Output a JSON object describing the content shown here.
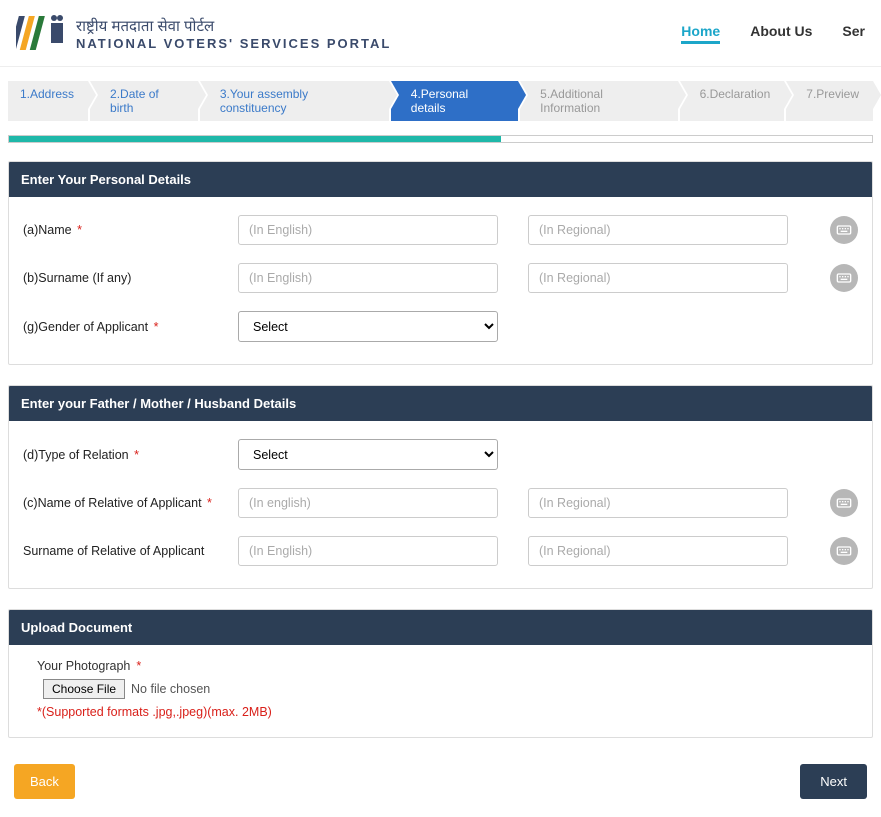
{
  "header": {
    "hindi": "राष्ट्रीय मतदाता सेवा पोर्टल",
    "english": "NATIONAL VOTERS' SERVICES PORTAL"
  },
  "nav": {
    "home": "Home",
    "about": "About Us",
    "ser": "Ser"
  },
  "steps": [
    {
      "label": "1.Address",
      "state": "done"
    },
    {
      "label": "2.Date of birth",
      "state": "done"
    },
    {
      "label": "3.Your assembly constituency",
      "state": "done"
    },
    {
      "label": "4.Personal details",
      "state": "active"
    },
    {
      "label": "5.Additional Information",
      "state": "future"
    },
    {
      "label": "6.Declaration",
      "state": "future"
    },
    {
      "label": "7.Preview",
      "state": "future"
    }
  ],
  "progress_percent": 57,
  "sections": {
    "personal": {
      "title": "Enter Your Personal Details",
      "name_label": "(a)Name",
      "surname_label": "(b)Surname (If any)",
      "gender_label": "(g)Gender of Applicant"
    },
    "relative": {
      "title": "Enter your Father / Mother / Husband Details",
      "relation_label": "(d)Type of Relation",
      "rel_name_label": "(c)Name of Relative of Applicant",
      "rel_surname_label": "Surname of Relative of Applicant"
    },
    "upload": {
      "title": "Upload Document",
      "photo_label": "Your Photograph",
      "choose_label": "Choose File",
      "file_status": "No file chosen",
      "hint": "*(Supported formats .jpg,.jpeg)(max. 2MB)"
    }
  },
  "placeholders": {
    "english": "(In English)",
    "regional": "(In Regional)",
    "english_lc": "(In english)"
  },
  "select_default": "Select",
  "buttons": {
    "back": "Back",
    "next": "Next"
  },
  "required_marker": "*"
}
